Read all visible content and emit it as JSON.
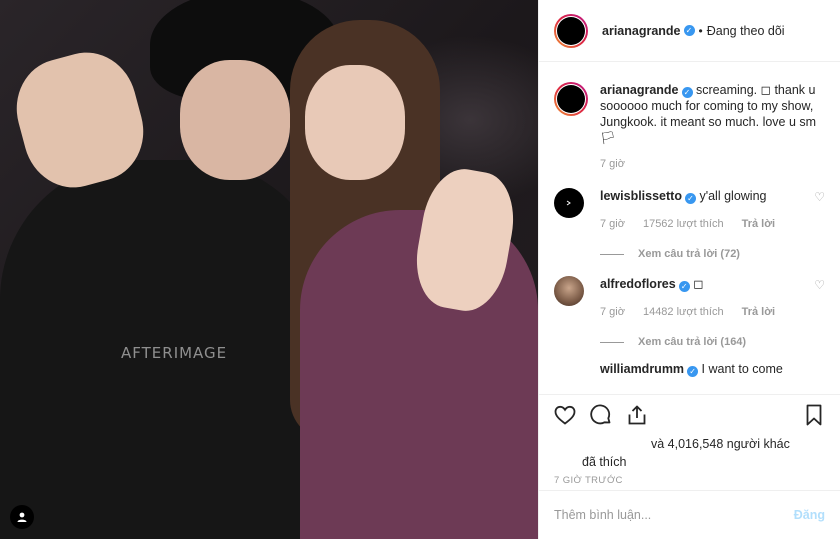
{
  "photo": {
    "shirt_text": "AFTERIMAGE"
  },
  "header": {
    "username": "arianagrande",
    "separator": "•",
    "follow_status": "Đang theo dõi"
  },
  "caption": {
    "username": "arianagrande",
    "text": "screaming. ◻ thank u soooooo much for coming to my show, Jungkook. it meant so much. love u sm🏳",
    "time": "7 giờ"
  },
  "comments": [
    {
      "username": "lewisblissetto",
      "text": "y'all glowing",
      "time": "7 giờ",
      "likes": "17562 lượt thích",
      "reply_label": "Trả lời",
      "view_replies": "Xem câu trả lời (72)"
    },
    {
      "username": "alfredoflores",
      "text": "◻",
      "time": "7 giờ",
      "likes": "14482 lượt thích",
      "reply_label": "Trả lời",
      "view_replies": "Xem câu trả lời (164)"
    },
    {
      "username": "williamdrumm",
      "text": "I want to come"
    }
  ],
  "likes_line1": "và 4,016,548 người khác",
  "likes_line2": "đã thích",
  "time_ago": "7 GIỜ TRƯỚC",
  "add_comment": {
    "placeholder": "Thêm bình luận...",
    "post_label": "Đăng"
  },
  "colors": {
    "verified": "#3897f0",
    "post_disabled": "#b2dffc",
    "meta": "#999999"
  }
}
